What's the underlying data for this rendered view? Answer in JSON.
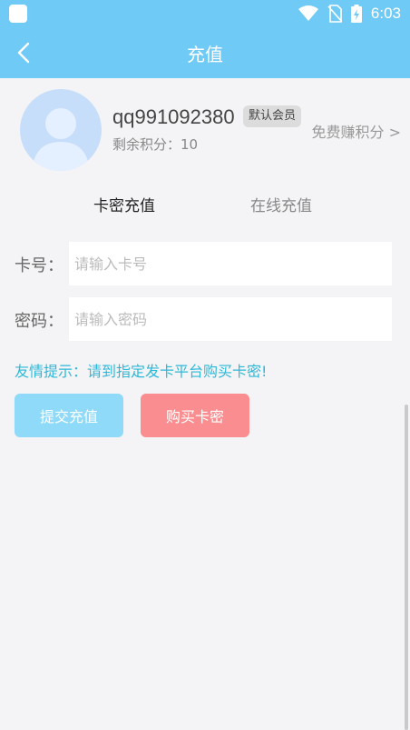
{
  "status_bar": {
    "time": "6:03",
    "icons": [
      "wifi-icon",
      "no-sim-icon",
      "battery-charging-icon"
    ]
  },
  "header": {
    "title": "充值",
    "back_icon": "chevron-left-icon"
  },
  "profile": {
    "username": "qq991092380",
    "badge": "默认会员",
    "points": "剩余积分：10",
    "earn_link": "免费赚积分 >"
  },
  "tabs": [
    {
      "label": "卡密充值",
      "active": true
    },
    {
      "label": "在线充值",
      "active": false
    }
  ],
  "form": {
    "card_label": "卡号：",
    "card_placeholder": "请输入卡号",
    "card_value": "",
    "password_label": "密码：",
    "password_placeholder": "请输入密码",
    "password_value": ""
  },
  "tip": "友情提示：请到指定发卡平台购买卡密!",
  "buttons": {
    "submit": "提交充值",
    "buy": "购买卡密"
  },
  "colors": {
    "header_bg": "#6fcaf6",
    "tip": "#2eb8d8",
    "submit_bg": "#8fdaf8",
    "buy_bg": "#fa8d8f"
  }
}
